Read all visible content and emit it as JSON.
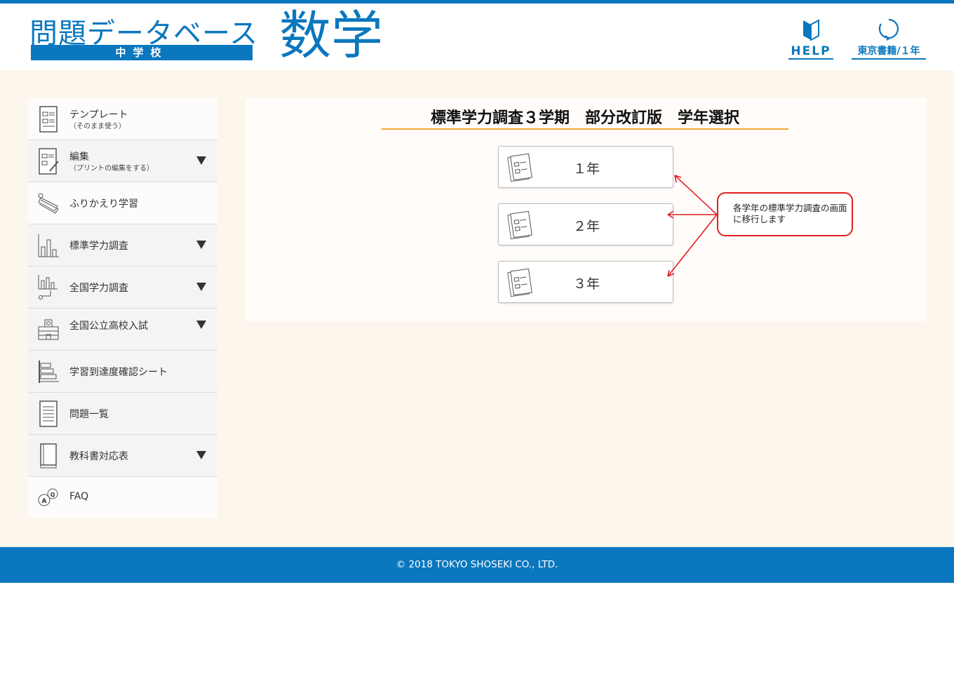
{
  "header": {
    "logo_title": "問題データベース",
    "logo_school": "中学校",
    "subject": "数学",
    "help_label": "HELP",
    "textbook_label": "東京書籍/１年",
    "accent_color": "#0a77be"
  },
  "sidebar": {
    "items": [
      {
        "label": "テンプレート",
        "sub": "（そのまま使う）",
        "icon": "template-icon",
        "has_arrow": false
      },
      {
        "label": "編集",
        "sub": "（プリントの編集をする）",
        "icon": "edit-icon",
        "has_arrow": true
      },
      {
        "label": "ふりかえり学習",
        "icon": "flashcard-icon",
        "has_arrow": false
      },
      {
        "label": "標準学力調査",
        "icon": "bar-chart-icon",
        "has_arrow": true
      },
      {
        "label": "全国学力調査",
        "icon": "chart-pointer-icon",
        "has_arrow": true
      },
      {
        "label": "全国公立高校入試",
        "icon": "school-building-icon",
        "has_arrow": true
      },
      {
        "label": "学習到達度確認シート",
        "icon": "checksheet-icon",
        "has_arrow": false
      },
      {
        "label": "問題一覧",
        "icon": "document-list-icon",
        "has_arrow": false
      },
      {
        "label": "教科書対応表",
        "icon": "textbook-icon",
        "has_arrow": true
      },
      {
        "label": "FAQ",
        "icon": "qa-bubbles-icon",
        "has_arrow": false
      }
    ]
  },
  "main": {
    "title": "標準学力調査３学期　部分改訂版　学年選択",
    "grades": [
      "１年",
      "２年",
      "３年"
    ],
    "callout": "各学年の標準学力調査の画面に移行します",
    "callout_color": "#e02020",
    "underline_color": "#f0a430"
  },
  "footer": {
    "copyright": "© 2018 TOKYO SHOSEKI CO., LTD."
  }
}
